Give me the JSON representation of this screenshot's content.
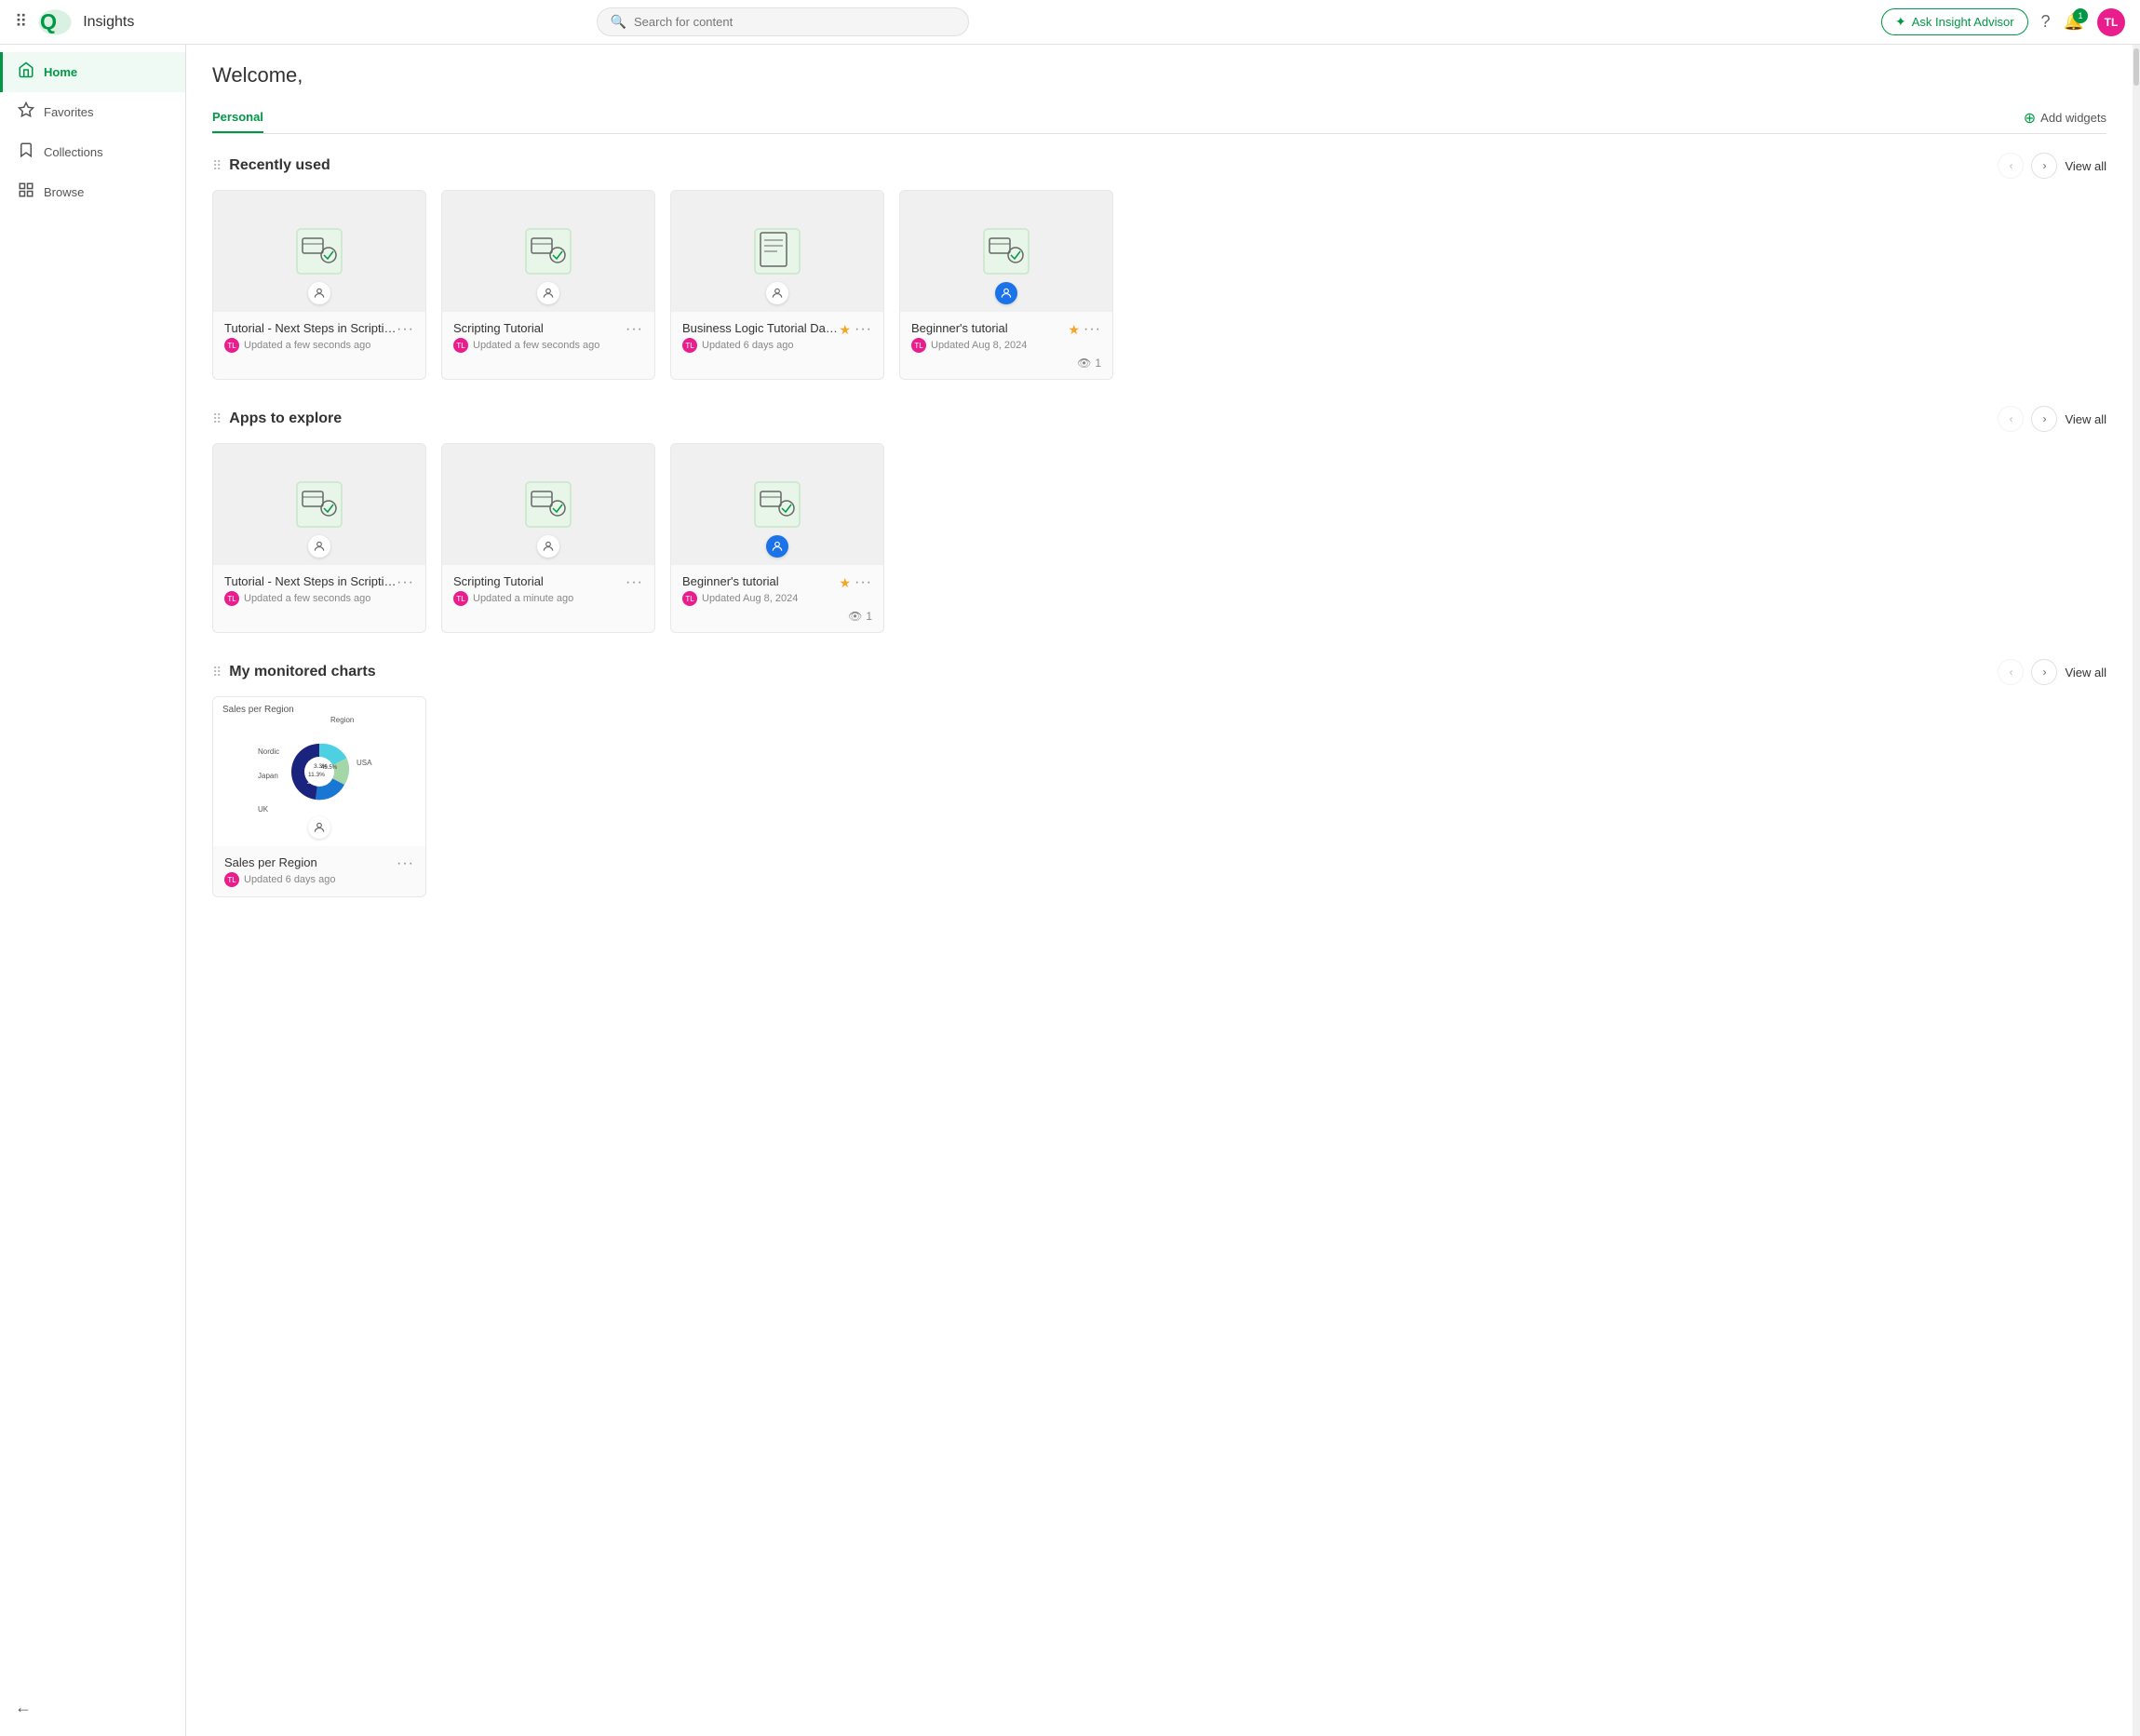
{
  "app": {
    "title": "Insights"
  },
  "topnav": {
    "search_placeholder": "Search for content",
    "ask_advisor_label": "Ask Insight Advisor",
    "help_icon": "question-circle",
    "notification_count": "1",
    "avatar_initials": "TL"
  },
  "sidebar": {
    "items": [
      {
        "id": "home",
        "label": "Home",
        "icon": "home",
        "active": true
      },
      {
        "id": "favorites",
        "label": "Favorites",
        "icon": "star"
      },
      {
        "id": "collections",
        "label": "Collections",
        "icon": "bookmark"
      },
      {
        "id": "browse",
        "label": "Browse",
        "icon": "grid"
      }
    ],
    "collapse_label": "Collapse"
  },
  "main": {
    "welcome": "Welcome,",
    "tabs": [
      {
        "id": "personal",
        "label": "Personal",
        "active": true
      }
    ],
    "add_widgets_label": "Add widgets",
    "recently_used": {
      "title": "Recently used",
      "view_all": "View all",
      "items": [
        {
          "name": "Tutorial - Next Steps in Scripting",
          "time": "Updated a few seconds ago",
          "starred": false,
          "owner_type": "user"
        },
        {
          "name": "Scripting Tutorial",
          "time": "Updated a few seconds ago",
          "starred": false,
          "owner_type": "user"
        },
        {
          "name": "Business Logic Tutorial Data Prep",
          "time": "Updated 6 days ago",
          "starred": true,
          "owner_type": "user"
        },
        {
          "name": "Beginner's tutorial",
          "time": "Updated Aug 8, 2024",
          "starred": true,
          "owner_type": "qlik"
        }
      ],
      "views": "1"
    },
    "apps_to_explore": {
      "title": "Apps to explore",
      "view_all": "View all",
      "items": [
        {
          "name": "Tutorial - Next Steps in Scripting",
          "time": "Updated a few seconds ago",
          "starred": false,
          "owner_type": "user"
        },
        {
          "name": "Scripting Tutorial",
          "time": "Updated a minute ago",
          "starred": false,
          "owner_type": "user"
        },
        {
          "name": "Beginner's tutorial",
          "time": "Updated Aug 8, 2024",
          "starred": true,
          "owner_type": "qlik"
        }
      ],
      "views": "1"
    },
    "my_monitored_charts": {
      "title": "My monitored charts",
      "view_all": "View all",
      "items": [
        {
          "name": "Sales per Region",
          "time": "Updated 6 days ago",
          "chart_title": "Sales per Region",
          "legend": {
            "label": "Region",
            "segments": [
              {
                "label": "Nordic",
                "color": "#009845",
                "pct": 3.3
              },
              {
                "label": "Japan",
                "color": "#2196f3",
                "pct": 11.3
              },
              {
                "label": "UK",
                "color": "#1a237e",
                "pct": 26.9
              },
              {
                "label": "USA",
                "color": "#00bcd4",
                "pct": 45.5
              }
            ]
          },
          "owner_type": "user_pink"
        }
      ]
    }
  },
  "icons": {
    "drag": "⠿",
    "eye": "👁",
    "chevron_left": "‹",
    "chevron_right": "›",
    "plus": "+",
    "star_empty": "☆",
    "star_filled": "★",
    "more": "•••",
    "user_icon": "👤",
    "search": "🔍",
    "spark": "✦",
    "collapse": "←"
  }
}
